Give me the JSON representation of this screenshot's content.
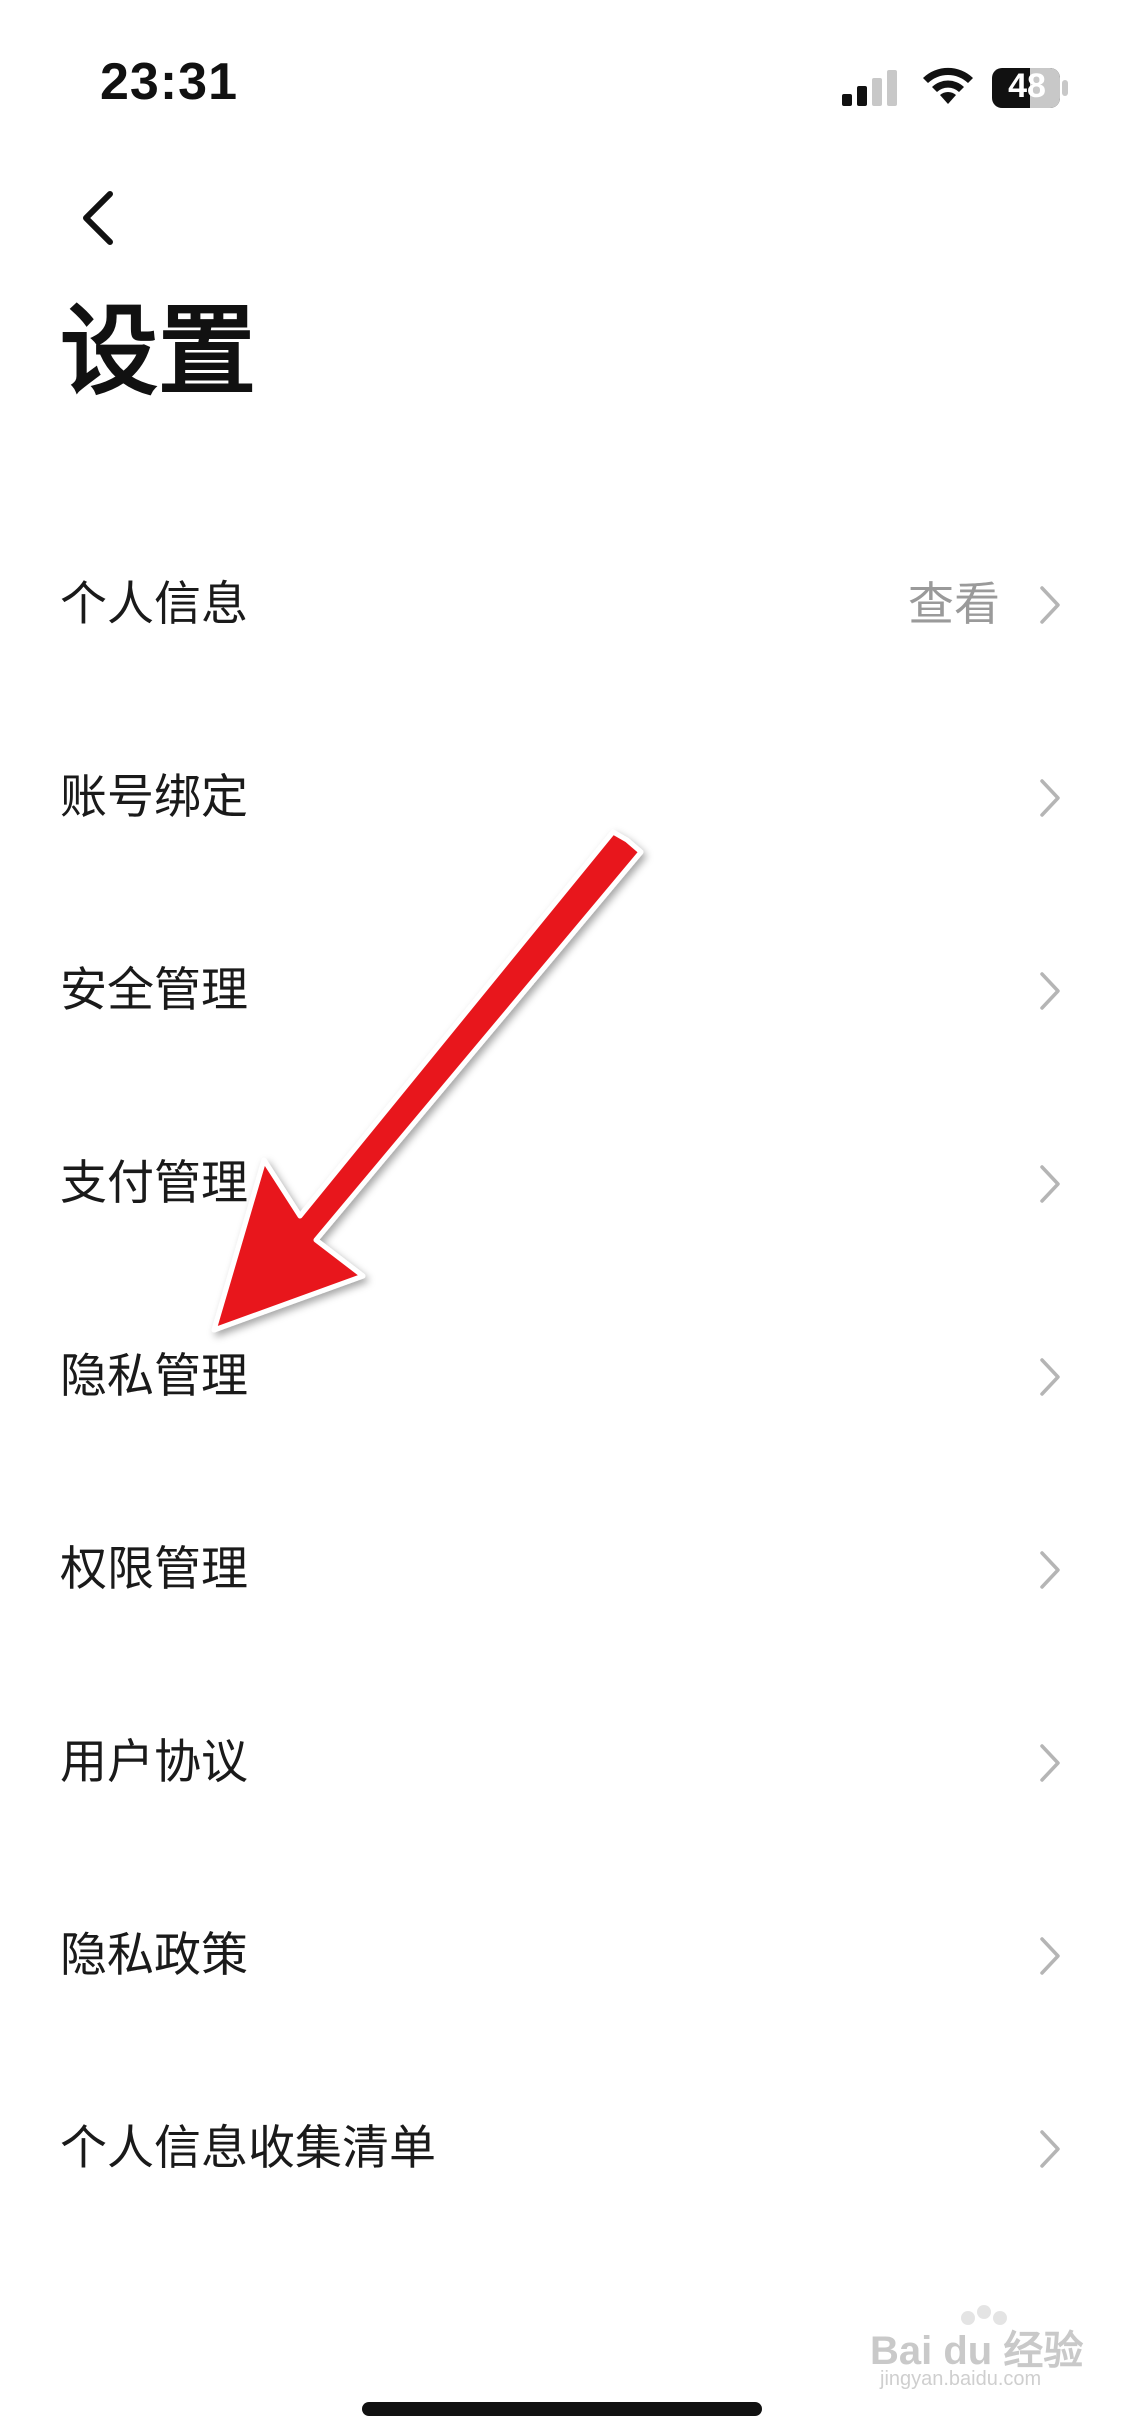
{
  "status_bar": {
    "time": "23:31",
    "battery": "48",
    "icons": [
      "signal-icon",
      "wifi-icon",
      "battery-icon"
    ]
  },
  "header": {
    "back_icon": "chevron-left-icon",
    "title": "设置"
  },
  "settings": {
    "items": [
      {
        "label": "个人信息",
        "value": "查看"
      },
      {
        "label": "账号绑定",
        "value": ""
      },
      {
        "label": "安全管理",
        "value": ""
      },
      {
        "label": "支付管理",
        "value": ""
      },
      {
        "label": "隐私管理",
        "value": ""
      },
      {
        "label": "权限管理",
        "value": ""
      },
      {
        "label": "用户协议",
        "value": ""
      },
      {
        "label": "隐私政策",
        "value": ""
      },
      {
        "label": "个人信息收集清单",
        "value": ""
      }
    ]
  },
  "annotation": {
    "color": "#e8131b",
    "points_to": "隐私管理"
  },
  "watermark": {
    "text": "Bai du 经验",
    "sub": "jingyan.baidu.com"
  },
  "colors": {
    "text_primary": "#1a1a1a",
    "text_secondary": "#9a9a9a",
    "chevron": "#b5b5b5",
    "background": "#ffffff"
  }
}
